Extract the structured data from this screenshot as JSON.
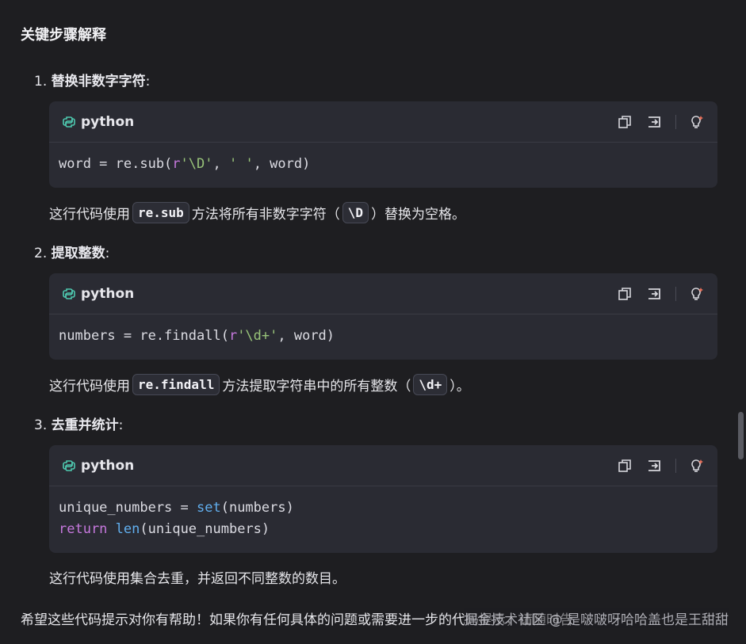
{
  "heading": "关键步骤解释",
  "steps": [
    {
      "number": "1.",
      "title": "替换非数字字符",
      "colon": ":",
      "code_lang": "python",
      "code_lines": [
        "word = re.sub(r'\\D', ' ', word)"
      ],
      "desc_before": "这行代码使用",
      "desc_code": "re.sub",
      "desc_middle": "方法将所有非数字字符（",
      "desc_code2": "\\D",
      "desc_after": "）替换为空格。"
    },
    {
      "number": "2.",
      "title": "提取整数",
      "colon": ":",
      "code_lang": "python",
      "code_lines": [
        "numbers = re.findall(r'\\d+', word)"
      ],
      "desc_before": "这行代码使用",
      "desc_code": "re.findall",
      "desc_middle": "方法提取字符串中的所有整数（",
      "desc_code2": "\\d+",
      "desc_after": "）。"
    },
    {
      "number": "3.",
      "title": "去重并统计",
      "colon": ":",
      "code_lang": "python",
      "code_lines": [
        "unique_numbers = set(numbers)",
        "return len(unique_numbers)"
      ],
      "desc_before": "这行代码使用集合去重，并返回不同整数的数目。"
    }
  ],
  "footer": "希望这些代码提示对你有帮助！如果你有任何具体的问题或需要进一步的代码提示，请随时告",
  "watermark": "掘金技术社区 @ 是啵啵呀哈哈盖也是王甜甜",
  "icons": {
    "lang": "python-icon",
    "copy": "copy-icon",
    "insert": "insert-code-icon",
    "explain": "lightbulb-icon"
  },
  "colors": {
    "background": "#1e1e21",
    "card": "#2a2b33",
    "string": "#98c379",
    "keyword": "#c678dd",
    "builtin": "#61afef"
  }
}
